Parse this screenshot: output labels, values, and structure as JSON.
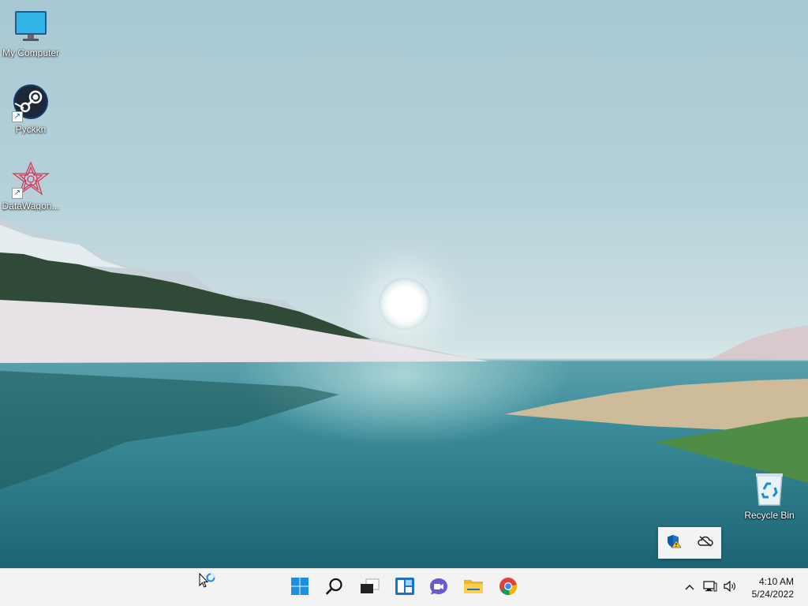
{
  "desktop": {
    "icons": [
      {
        "label": "My Computer",
        "icon": "computer-icon",
        "shortcut": false
      },
      {
        "label": "Pyckkn",
        "icon": "steam-icon",
        "shortcut": true
      },
      {
        "label": "DataWagon...",
        "icon": "datawagon-icon",
        "shortcut": true
      },
      {
        "label": "Recycle Bin",
        "icon": "recycle-bin-icon",
        "shortcut": false
      }
    ]
  },
  "tray_popup": {
    "items": [
      {
        "icon": "windows-security-warning-icon"
      },
      {
        "icon": "onedrive-offline-icon"
      }
    ]
  },
  "taskbar": {
    "apps": [
      {
        "icon": "start-icon"
      },
      {
        "icon": "search-icon"
      },
      {
        "icon": "task-view-icon"
      },
      {
        "icon": "widgets-icon"
      },
      {
        "icon": "teams-chat-icon"
      },
      {
        "icon": "file-explorer-icon"
      },
      {
        "icon": "chrome-icon"
      }
    ],
    "system": {
      "icons": [
        "chevron-up-icon",
        "network-icon",
        "volume-icon"
      ],
      "time": "4:10 AM",
      "date": "5/24/2022"
    }
  },
  "colors": {
    "accent": "#0078d4",
    "taskbar_bg": "#f3f3f3"
  }
}
